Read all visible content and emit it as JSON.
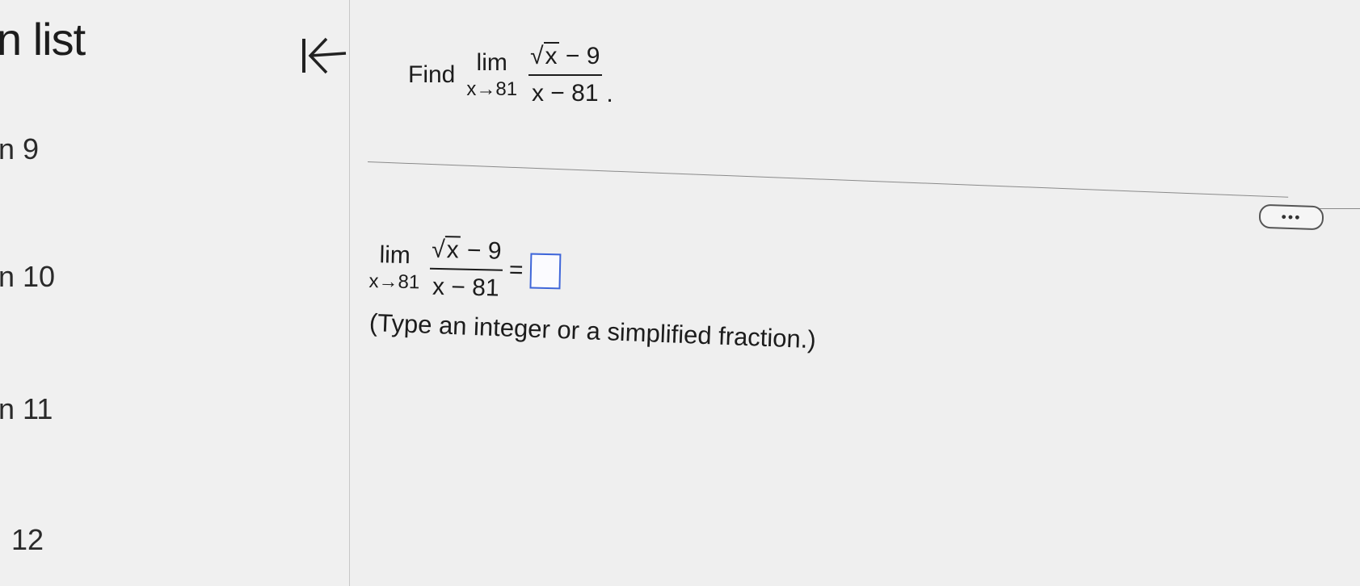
{
  "sidebar": {
    "title": "n list",
    "items": [
      {
        "label": "n 9"
      },
      {
        "label": "n 10"
      },
      {
        "label": "n 11"
      },
      {
        "label": "12"
      }
    ]
  },
  "question": {
    "prefix": "Find",
    "lim_word": "lim",
    "lim_sub": "x→81",
    "numerator_sqrt": "x",
    "numerator_rest": " − 9",
    "denominator": "x − 81",
    "period": "."
  },
  "more_button": {
    "label": "•••"
  },
  "answer": {
    "lim_word": "lim",
    "lim_sub": "x→81",
    "numerator_sqrt": "x",
    "numerator_rest": " − 9",
    "denominator": "x − 81",
    "equals": "=",
    "value": "",
    "hint": "(Type an integer or a simplified fraction.)"
  },
  "colors": {
    "accent": "#1193c0",
    "input_border": "#3f66d9"
  }
}
